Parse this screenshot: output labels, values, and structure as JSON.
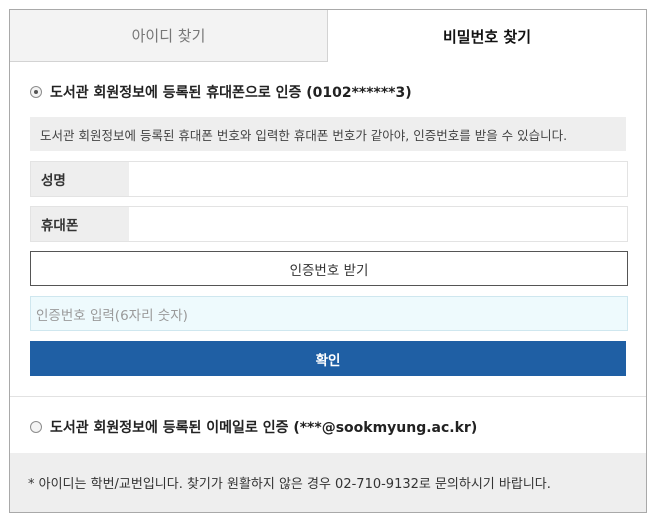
{
  "tabs": {
    "find_id": "아이디 찾기",
    "find_password": "비밀번호 찾기"
  },
  "phone_option": {
    "label": "도서관 회원정보에 등록된 휴대폰으로 인증 (0102******3)",
    "selected": true
  },
  "notice": "도서관 회원정보에 등록된 휴대폰 번호와 입력한 휴대폰 번호가 같아야, 인증번호를 받을 수 있습니다.",
  "form": {
    "name_label": "성명",
    "name_value": "",
    "phone_label": "휴대폰",
    "phone_value": ""
  },
  "buttons": {
    "get_code": "인증번호 받기",
    "confirm": "확인"
  },
  "code_input": {
    "placeholder": "인증번호 입력(6자리 숫자)",
    "value": ""
  },
  "email_option": {
    "label": "도서관 회원정보에 등록된 이메일로 인증 (***@sookmyung.ac.kr)",
    "selected": false
  },
  "footer_note": "* 아이디는 학번/교번입니다. 찾기가 원활하지 않은 경우 02-710-9132로 문의하시기 바랍니다.",
  "colors": {
    "primary": "#1f5fa4",
    "code_input_bg": "#eefafd",
    "gray_bg": "#eeeeee"
  }
}
